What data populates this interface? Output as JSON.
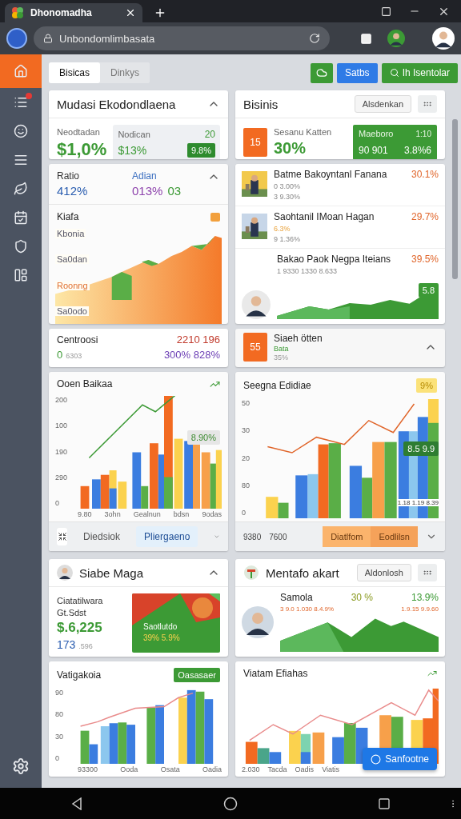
{
  "browser": {
    "tab_title": "Dhonomadha",
    "url": "Unbondomlimbasata"
  },
  "sidebar": [
    {
      "selected": true,
      "badge": false
    },
    {
      "selected": false,
      "badge": true
    },
    {
      "selected": false,
      "badge": false
    },
    {
      "selected": false,
      "badge": false
    },
    {
      "selected": false,
      "badge": false
    },
    {
      "selected": false,
      "badge": false
    },
    {
      "selected": false,
      "badge": false
    },
    {
      "selected": false,
      "badge": false
    }
  ],
  "toolbar": {
    "tabs": [
      {
        "label": "Bisicas",
        "selected": true
      },
      {
        "label": "Dinkys",
        "selected": false
      }
    ],
    "actions": [
      {
        "kind": "icon"
      },
      {
        "kind": "primary",
        "label": "Satbs"
      },
      {
        "kind": "success",
        "label": "Ih Isentolar"
      }
    ]
  },
  "left": {
    "summary": {
      "title": "Mudasi Ekodondlaena",
      "expanded": true,
      "label": "Neodtadan",
      "value": "$1,0%",
      "side": {
        "label": "Nodican",
        "corner": "20",
        "value": "$13%",
        "badge": "9.8%"
      }
    },
    "ratio": {
      "expanded": true,
      "stats": [
        {
          "label": "Ratio",
          "value": "412%"
        },
        {
          "label": "Adian",
          "value": "013%",
          "extra": "03"
        }
      ],
      "chart": {
        "title": "Kiafa",
        "axis_labels": [
          "Kbonia",
          "Sa0dan",
          "Roonng",
          "Sa0odo"
        ]
      }
    },
    "centroosi": {
      "title": "Centroosi",
      "value": "2210 196",
      "sub": "0",
      "sub_note": "6303",
      "percents": "300% 828%"
    },
    "bar_chart": {
      "title": "Ooen Baikaa",
      "yticks": [
        "200",
        "100",
        "190",
        "290",
        "0"
      ],
      "xlabels": [
        "9.80",
        "3ohn",
        "Gealnun",
        "bdsn",
        "9odas"
      ],
      "tooltip": "8.90%",
      "footer": [
        {
          "label": "Diedsiok",
          "selected": false
        },
        {
          "label": "Pliergaeno",
          "selected": true
        }
      ]
    },
    "profile": {
      "title": "Siabe Maga",
      "expanded": true,
      "label": "Ciatatilwara",
      "sublabel": "Gt.Sdst",
      "value": "$.6,225",
      "count": "173",
      "count_note": ".596",
      "promo": {
        "title": "Saotlutdo",
        "values": "39% 5.9%"
      }
    },
    "chart2": {
      "title": "Vatigakoia",
      "badge": "Oasasaer",
      "yticks": [
        "90",
        "80",
        "30",
        "0"
      ],
      "xlabels": [
        "93300",
        "Ooda",
        "Osata",
        "Oadia"
      ]
    }
  },
  "right": {
    "business": {
      "title": "Bisinis",
      "button": "Alsdenkan",
      "tile": "15",
      "label": "Sesanu Katten",
      "value": "30%",
      "panel": {
        "label": "Maeboro",
        "corner": "1:10",
        "value": "90 901",
        "change": "3.8%6"
      }
    },
    "list": [
      {
        "kind": "thumb",
        "name": "Batme Bakoyntanl Fanana",
        "change": "30.1%",
        "lines": [
          "0 3.00%",
          "3 9.30%"
        ]
      },
      {
        "kind": "thumb",
        "name": "Saohtanil IMoan Hagan",
        "change": "29.7%",
        "lines": [
          "6.3%",
          "9 1.36%"
        ]
      },
      {
        "kind": "chart",
        "name": "Bakao Paok Negpa Iteians",
        "change": "39.5%",
        "lines": [
          "1 9330 1330 8.633"
        ],
        "badge": "5.8"
      }
    ],
    "slack": {
      "tile": "55",
      "title": "Siaeh ötten",
      "status": "Bata",
      "value": "35%",
      "expanded": true
    },
    "bar_chart": {
      "title": "Seegna Edidiae",
      "badge": "9%",
      "yticks": [
        "50",
        "30",
        "20",
        "80",
        "0"
      ],
      "xlabels": [
        "9380",
        "7600"
      ],
      "tooltip": "8.5 9.9",
      "note": "1.18 1.19 8.39",
      "footer": [
        "Diatlfom",
        "Eodlilsn"
      ]
    },
    "mentafo": {
      "title": "Mentafo akart",
      "button": "Aldonlosh",
      "label": "Samola",
      "value": "30 %",
      "change": "13.9%",
      "note": "3 9.0 1.030 8.4.9%",
      "note2": "1.9.15 9.9.60"
    },
    "chart2": {
      "title": "Viatam Efiahas",
      "xlabels": [
        "2.030",
        "Tacda",
        "Oadis",
        "Viatis"
      ],
      "fab": "Sanfootne"
    }
  }
}
